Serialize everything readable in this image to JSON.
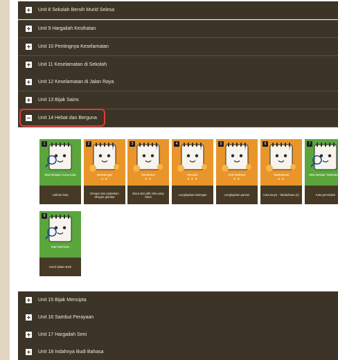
{
  "units_above": [
    {
      "label": "Unit 8 Sekolah Bersih Murid Selesa",
      "state": "plus"
    },
    {
      "label": "Unit 9 Hargailah Kesihatan",
      "state": "plus"
    },
    {
      "label": "Unit 10 Pentingnya Keselamatan",
      "state": "plus"
    },
    {
      "label": "Unit 11 Keselamatan di Sekolah",
      "state": "plus"
    },
    {
      "label": "Unit 12 Keselamatan di Jalan Raya",
      "state": "plus"
    },
    {
      "label": "Unit 13 Bijak Sains",
      "state": "plus"
    },
    {
      "label": "Unit 14 Hebat dan Berguna",
      "state": "minus"
    }
  ],
  "units_below": [
    {
      "label": "Unit 15 Bijak Mencipta",
      "state": "plus"
    },
    {
      "label": "Unit 16 Sambut Perayaan",
      "state": "plus"
    },
    {
      "label": "Unit 17 Hargailah Seni",
      "state": "plus"
    },
    {
      "label": "Unit 18 Indahnya Budi Bahasa",
      "state": "plus"
    }
  ],
  "cards": [
    {
      "num": "1",
      "title": "Mari Belajar Kosa Kata",
      "stars": "",
      "sub": "Latihan kata",
      "theme": "green"
    },
    {
      "num": "2",
      "title": "Mendengar",
      "stars": "★★",
      "sub": "Dengar dan padankan dengan gambar",
      "theme": "orange"
    },
    {
      "num": "3",
      "title": "Membaca",
      "stars": "★★",
      "sub": "Baca dan pilih nilai yang betul",
      "theme": "orange"
    },
    {
      "num": "4",
      "title": "Menulis",
      "stars": "★★★",
      "sub": "Lengkapkan kalengan",
      "theme": "orange"
    },
    {
      "num": "5",
      "title": "Seni Bahasa",
      "stars": "★★",
      "sub": "Lengkapkan pantun",
      "theme": "orange"
    },
    {
      "num": "6",
      "title": "Tatabahasa",
      "stars": "★★",
      "sub": "Kata tanya - Tatabahasa (2)",
      "theme": "orange"
    },
    {
      "num": "7",
      "title": "Mari Belajar Tatabahasa",
      "stars": "",
      "sub": "Kata pemindah",
      "theme": "green"
    },
    {
      "num": "8",
      "title": "Mari Bermain",
      "stars": "",
      "sub": "Huruf dalam Buih",
      "theme": "green"
    }
  ],
  "colors": {
    "row_bg": "#3b3427",
    "highlight": "#e53935",
    "green_card": "#5aa63c",
    "orange_card": "#e9952a",
    "card_bottom": "#463a26"
  }
}
